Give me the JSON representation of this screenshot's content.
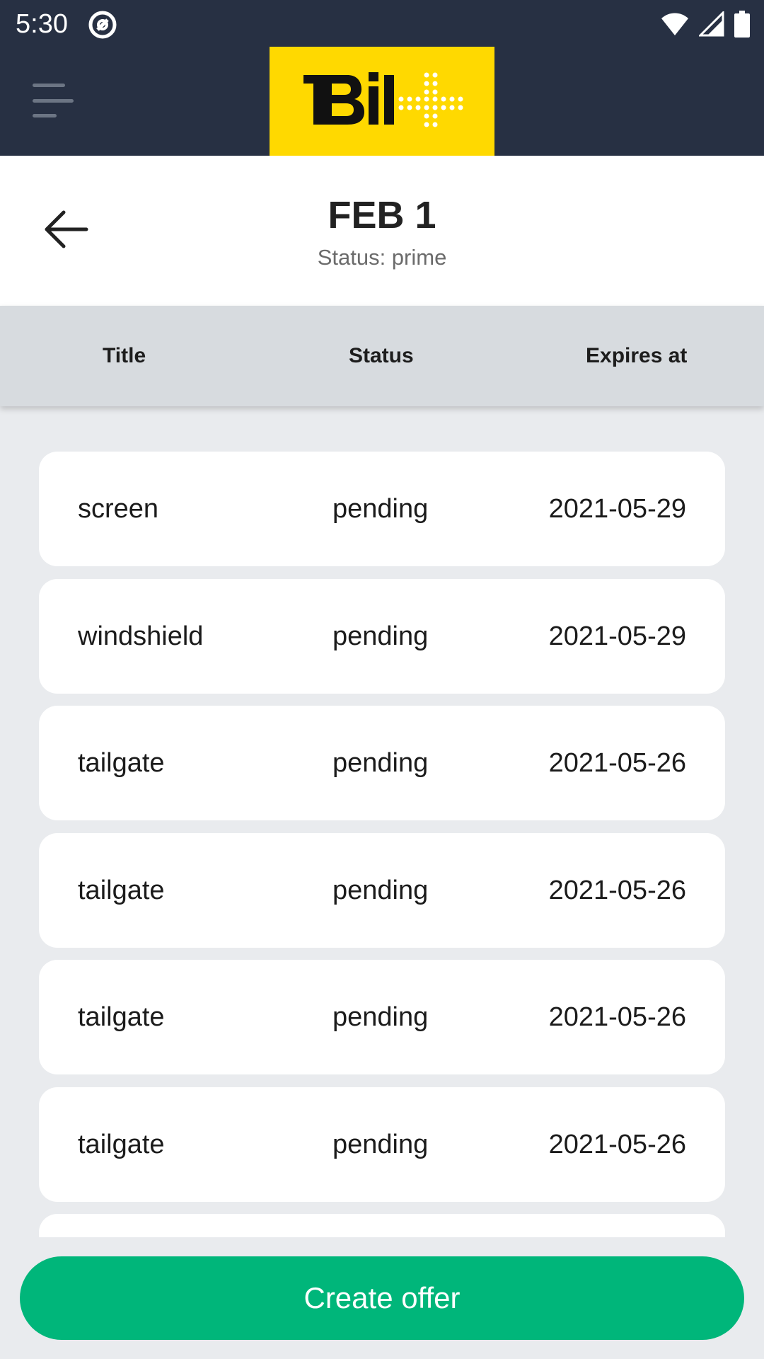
{
  "status_bar": {
    "time": "5:30",
    "icons": [
      "app-notification-icon",
      "wifi-icon",
      "cell-signal-icon",
      "battery-icon"
    ]
  },
  "app_bar": {
    "menu_icon": "hamburger-menu-icon",
    "logo_text": "Bil+"
  },
  "header": {
    "title": "FEB 1",
    "subtitle": "Status: prime",
    "back_icon": "arrow-left-icon"
  },
  "columns": {
    "title": "Title",
    "status": "Status",
    "expires": "Expires at"
  },
  "rows": [
    {
      "title": "screen",
      "status": "pending",
      "expires": "2021-05-29"
    },
    {
      "title": "windshield",
      "status": "pending",
      "expires": "2021-05-29"
    },
    {
      "title": "tailgate",
      "status": "pending",
      "expires": "2021-05-26"
    },
    {
      "title": "tailgate",
      "status": "pending",
      "expires": "2021-05-26"
    },
    {
      "title": "tailgate",
      "status": "pending",
      "expires": "2021-05-26"
    },
    {
      "title": "tailgate",
      "status": "pending",
      "expires": "2021-05-26"
    }
  ],
  "cta": {
    "label": "Create offer"
  },
  "colors": {
    "app_bar": "#273043",
    "logo_bg": "#ffd900",
    "cta": "#00b67a",
    "background": "#e9ebee",
    "header_row": "#d7dbdf"
  }
}
